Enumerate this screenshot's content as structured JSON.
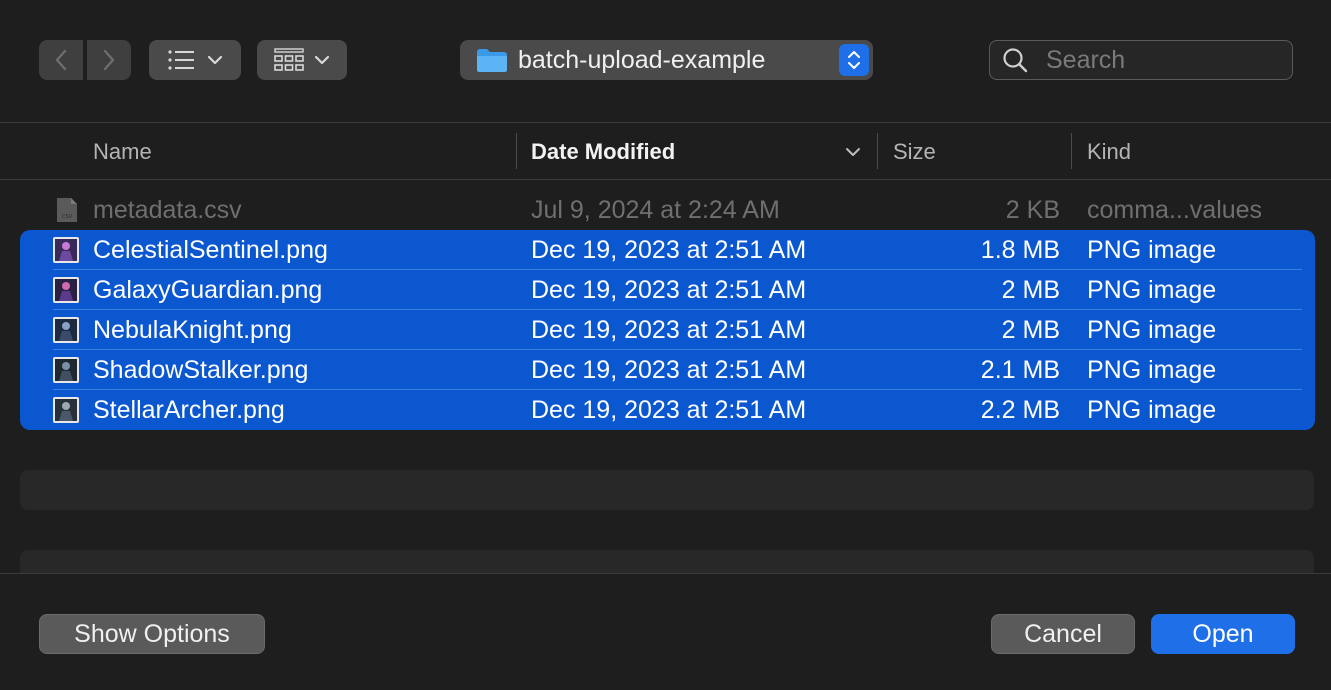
{
  "toolbar": {
    "back_icon": "chevron-left-icon",
    "forward_icon": "chevron-right-icon",
    "view_list_icon": "list-view-icon",
    "group_icon": "grid-view-icon",
    "folder_name": "batch-upload-example",
    "search_placeholder": "Search"
  },
  "columns": {
    "name": "Name",
    "date": "Date Modified",
    "size": "Size",
    "kind": "Kind"
  },
  "files": [
    {
      "name": "metadata.csv",
      "date": "Jul 9, 2024 at 2:24 AM",
      "size": "2 KB",
      "kind": "comma...values",
      "selected": false,
      "icon": "csv-file-icon"
    },
    {
      "name": "CelestialSentinel.png",
      "date": "Dec 19, 2023 at 2:51 AM",
      "size": "1.8 MB",
      "kind": "PNG image",
      "selected": true,
      "icon": "image-thumbnail-icon"
    },
    {
      "name": "GalaxyGuardian.png",
      "date": "Dec 19, 2023 at 2:51 AM",
      "size": "2 MB",
      "kind": "PNG image",
      "selected": true,
      "icon": "image-thumbnail-icon"
    },
    {
      "name": "NebulaKnight.png",
      "date": "Dec 19, 2023 at 2:51 AM",
      "size": "2 MB",
      "kind": "PNG image",
      "selected": true,
      "icon": "image-thumbnail-icon"
    },
    {
      "name": "ShadowStalker.png",
      "date": "Dec 19, 2023 at 2:51 AM",
      "size": "2.1 MB",
      "kind": "PNG image",
      "selected": true,
      "icon": "image-thumbnail-icon"
    },
    {
      "name": "StellarArcher.png",
      "date": "Dec 19, 2023 at 2:51 AM",
      "size": "2.2 MB",
      "kind": "PNG image",
      "selected": true,
      "icon": "image-thumbnail-icon"
    }
  ],
  "footer": {
    "show_options": "Show Options",
    "cancel": "Cancel",
    "open": "Open"
  },
  "colors": {
    "background": "#1e1e1e",
    "selection": "#0b57d0",
    "accent": "#1f6fe8"
  }
}
